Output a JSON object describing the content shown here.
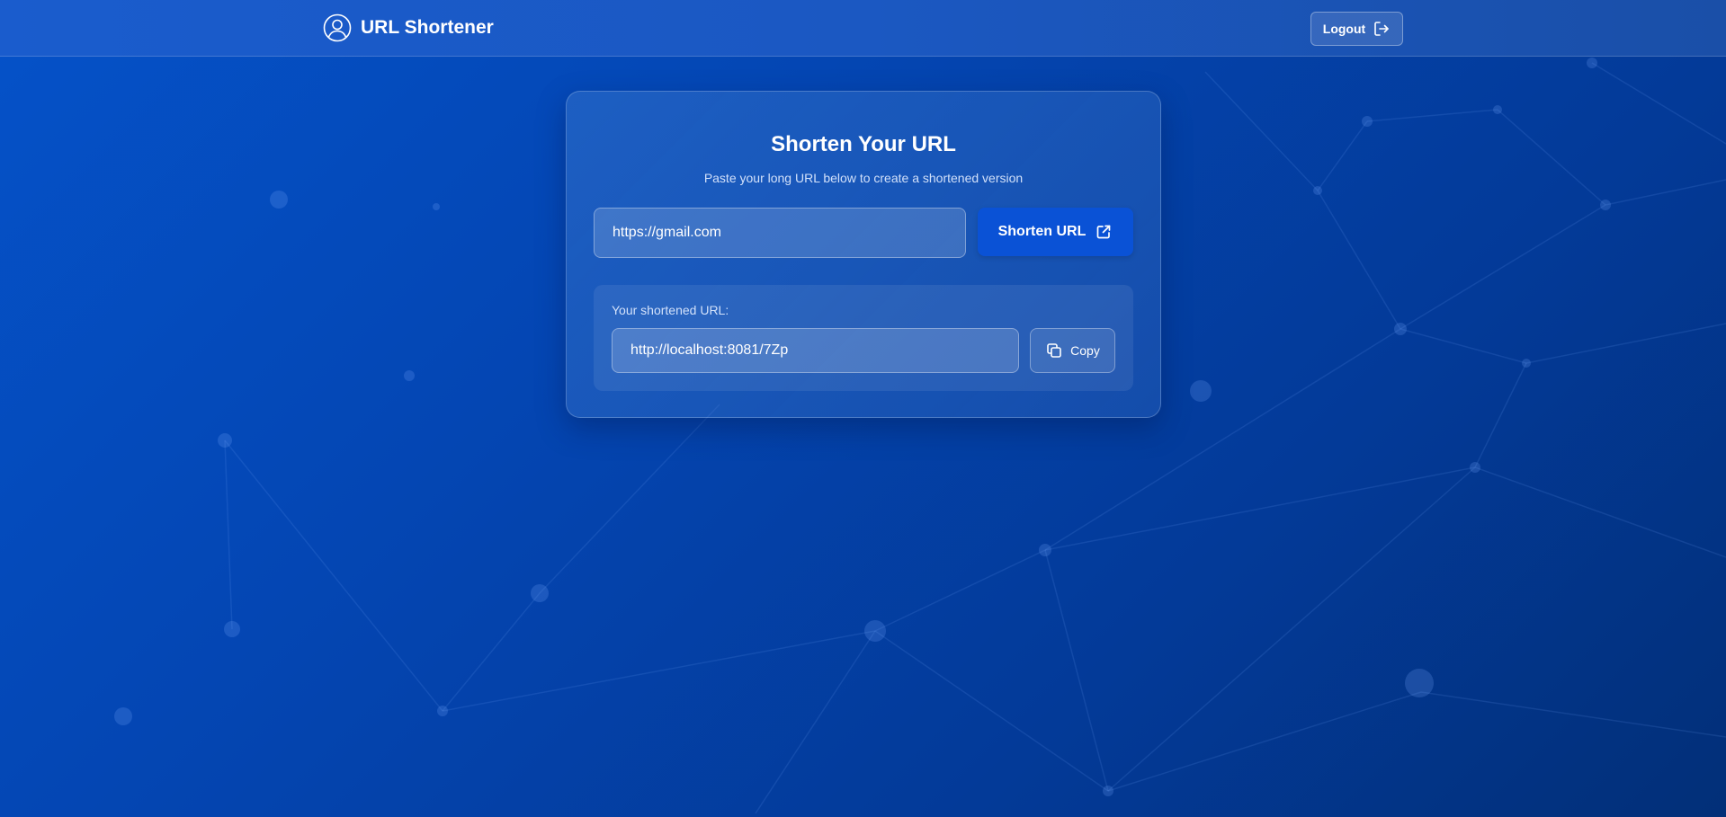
{
  "header": {
    "app_title": "URL Shortener",
    "logout_label": "Logout"
  },
  "card": {
    "title": "Shorten Your URL",
    "subtitle": "Paste your long URL below to create a shortened version",
    "url_input_value": "https://gmail.com",
    "shorten_button_label": "Shorten URL",
    "result_label": "Your shortened URL:",
    "short_url_value": "http://localhost:8081/7Zp",
    "copy_button_label": "Copy"
  },
  "icons": {
    "brand": "user-circle-icon",
    "logout": "logout-icon",
    "shorten": "external-link-icon",
    "copy": "copy-icon"
  },
  "colors": {
    "background": "#0446b3",
    "header": "#1b58c2",
    "primary_button": "#0a52d6",
    "text": "#ffffff"
  }
}
